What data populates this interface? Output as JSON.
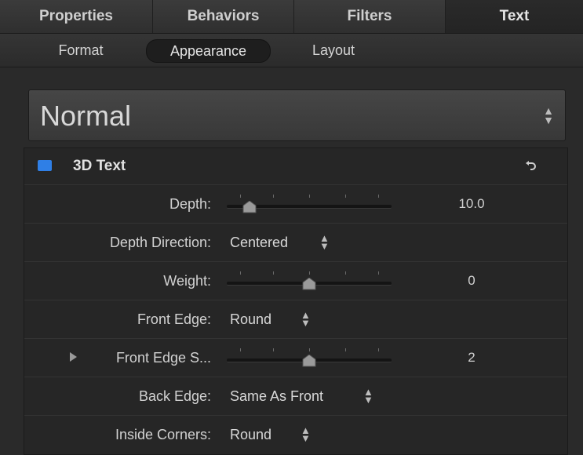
{
  "tabs": [
    {
      "label": "Properties"
    },
    {
      "label": "Behaviors"
    },
    {
      "label": "Filters"
    },
    {
      "label": "Text"
    }
  ],
  "subtabs": [
    {
      "label": "Format"
    },
    {
      "label": "Appearance"
    },
    {
      "label": "Layout"
    }
  ],
  "preset": {
    "value": "Normal"
  },
  "panel": {
    "title": "3D Text",
    "enabled": true,
    "accent": "#2f7fe6",
    "rows": [
      {
        "label": "Depth:",
        "value": "10.0",
        "slider_fraction": 0.14
      },
      {
        "label": "Depth Direction:",
        "popup": "Centered"
      },
      {
        "label": "Weight:",
        "value": "0",
        "slider_fraction": 0.5
      },
      {
        "label": "Front Edge:",
        "popup": "Round"
      },
      {
        "label": "Front Edge S...",
        "value": "2",
        "slider_fraction": 0.5
      },
      {
        "label": "Back Edge:",
        "popup": "Same As Front"
      },
      {
        "label": "Inside Corners:",
        "popup": "Round"
      }
    ]
  }
}
